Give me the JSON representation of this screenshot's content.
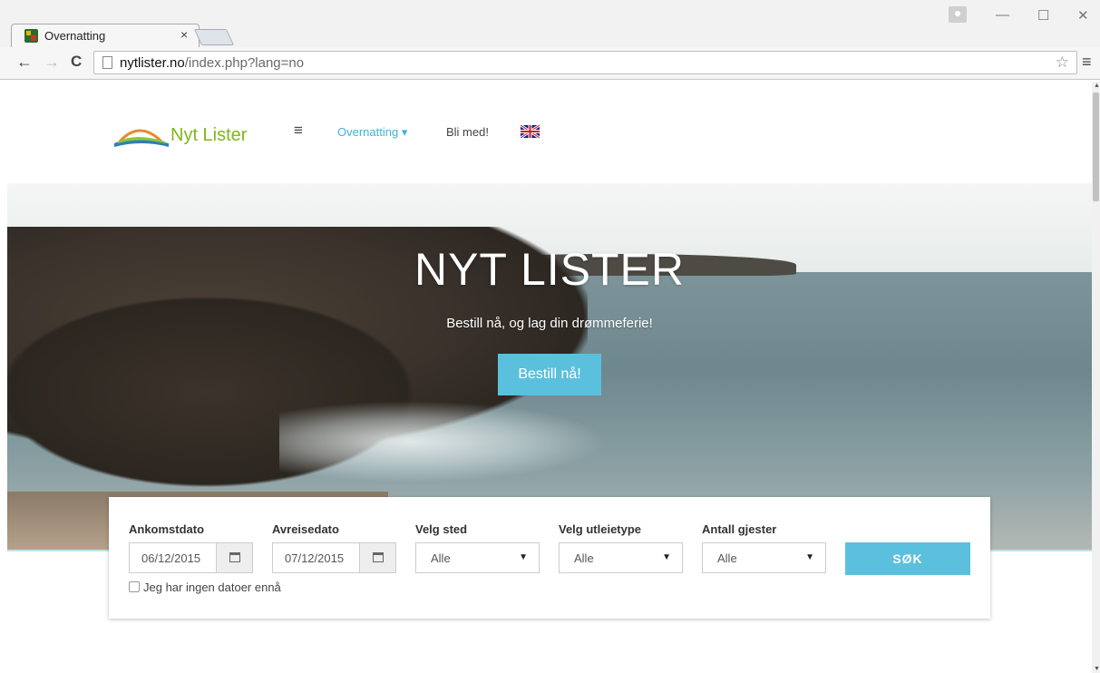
{
  "browser": {
    "tab_title": "Overnatting",
    "tab_close": "×",
    "url_host": "nytlister.no",
    "url_path": "/index.php?lang=no",
    "back": "←",
    "forward": "→",
    "reload": "C",
    "star": "☆",
    "menu": "≡",
    "minimize": "—",
    "maximize": "☐",
    "close": "✕"
  },
  "header": {
    "logo_text": "Nyt Lister",
    "hamburger": "≡",
    "nav": [
      {
        "label": "Overnatting ▾"
      },
      {
        "label": "Bli med!"
      }
    ]
  },
  "hero": {
    "title": "NYT LISTER",
    "subtitle": "Bestill nå, og lag din drømmeferie!",
    "cta": "Bestill nå!"
  },
  "search": {
    "arrival_label": "Ankomstdato",
    "arrival_value": "06/12/2015",
    "departure_label": "Avreisedato",
    "departure_value": "07/12/2015",
    "place_label": "Velg sted",
    "place_value": "Alle",
    "type_label": "Velg utleietype",
    "type_value": "Alle",
    "guests_label": "Antall gjester",
    "guests_value": "Alle",
    "button": "SØK",
    "no_dates_label": "Jeg har ingen datoer ennå",
    "select_arrow": "▼"
  },
  "colors": {
    "accent": "#5bc0de",
    "nav_active": "#3fb3d5",
    "logo_green": "#7fb71b"
  }
}
